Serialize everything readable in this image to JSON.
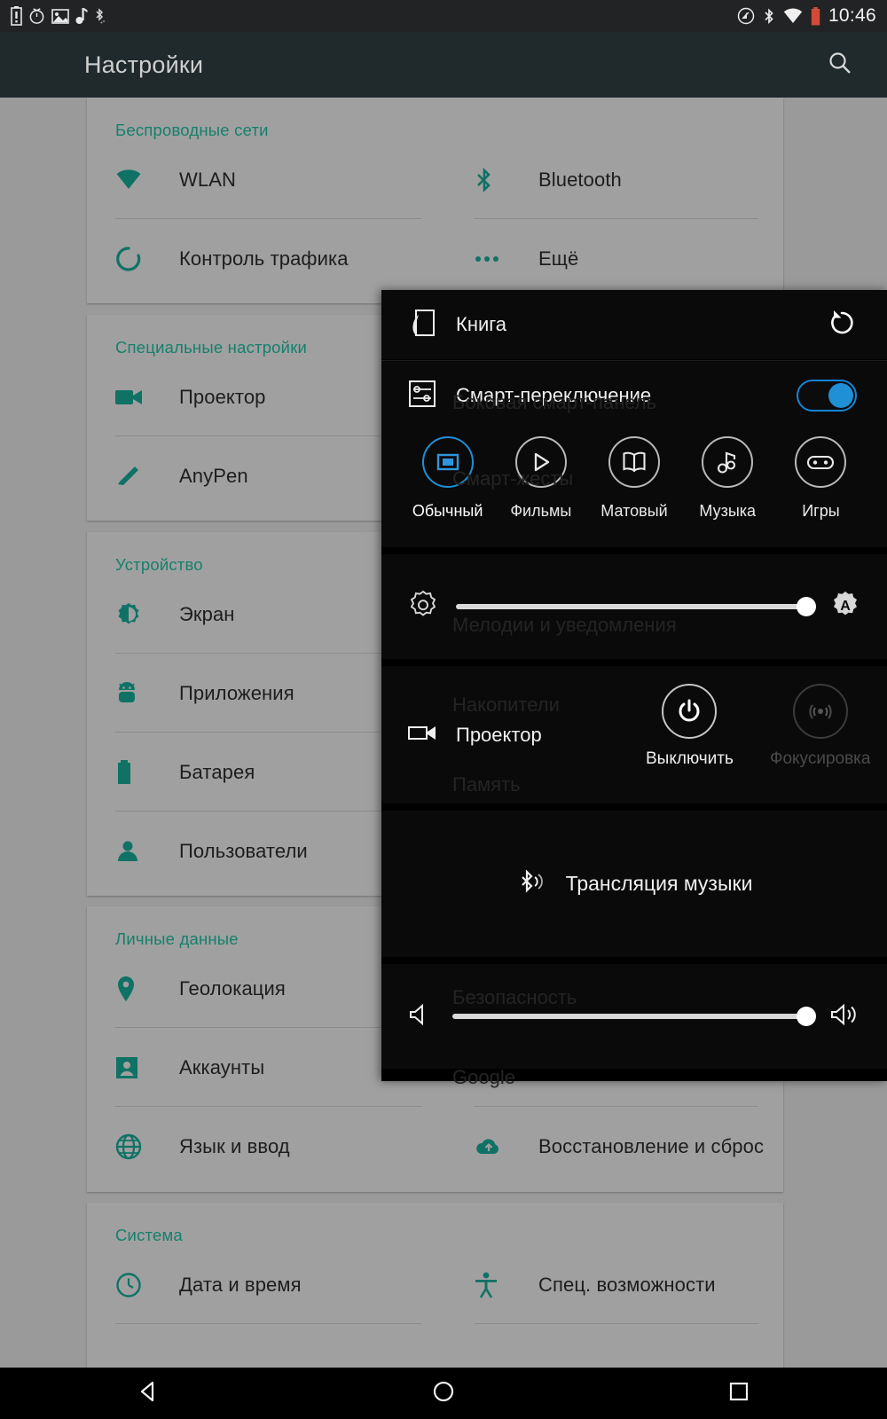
{
  "status_bar": {
    "time": "10:46",
    "left_icons": [
      "battery-alert-icon",
      "alarm-icon",
      "screenshot-icon",
      "music-note-icon",
      "bluetooth-small-icon"
    ],
    "right_icons": [
      "cast-icon",
      "bluetooth-icon",
      "wifi-icon",
      "battery-icon"
    ]
  },
  "app_bar": {
    "title": "Настройки",
    "search_icon": "search-icon"
  },
  "settings": {
    "sections": [
      {
        "title": "Беспроводные сети",
        "left_items": [
          {
            "label": "WLAN",
            "icon": "wifi-icon"
          },
          {
            "label": "Контроль трафика",
            "icon": "data-usage-icon"
          }
        ],
        "right_items": [
          {
            "label": "Bluetooth",
            "icon": "bluetooth-icon"
          },
          {
            "label": "Ещё",
            "icon": "more-icon"
          }
        ]
      },
      {
        "title": "Специальные настройки",
        "left_items": [
          {
            "label": "Проектор",
            "icon": "projector-icon"
          },
          {
            "label": "AnyPen",
            "icon": "pen-icon"
          }
        ],
        "right_items": []
      },
      {
        "title": "Устройство",
        "left_items": [
          {
            "label": "Экран",
            "icon": "display-icon"
          },
          {
            "label": "Приложения",
            "icon": "android-icon"
          },
          {
            "label": "Батарея",
            "icon": "battery-icon"
          },
          {
            "label": "Пользователи",
            "icon": "person-icon"
          }
        ],
        "right_items": [
          {
            "label": "Боковая смарт-панель",
            "icon": "smart-panel-icon"
          },
          {
            "label": "Смарт-жесты",
            "icon": "gesture-icon"
          },
          {
            "label": "Мелодии и уведомления",
            "icon": "bell-icon"
          },
          {
            "label": "Накопители",
            "icon": "storage-icon"
          },
          {
            "label": "Память",
            "icon": "memory-icon"
          }
        ]
      },
      {
        "title": "Личные данные",
        "left_items": [
          {
            "label": "Геолокация",
            "icon": "location-icon"
          },
          {
            "label": "Аккаунты",
            "icon": "account-icon"
          },
          {
            "label": "Язык и ввод",
            "icon": "language-icon"
          }
        ],
        "right_items": [
          {
            "label": "Безопасность",
            "icon": "lock-icon"
          },
          {
            "label": "Google",
            "icon": "google-icon"
          },
          {
            "label": "Восстановление и сброс",
            "icon": "backup-icon"
          }
        ]
      },
      {
        "title": "Система",
        "left_items": [
          {
            "label": "Дата и время",
            "icon": "clock-icon"
          }
        ],
        "right_items": [
          {
            "label": "Спец. возможности",
            "icon": "accessibility-icon"
          }
        ]
      }
    ]
  },
  "overlay_panel": {
    "header": {
      "title": "Книга",
      "icon": "book-mode-icon",
      "reset_icon": "reset-icon"
    },
    "smart_switch": {
      "label": "Смарт-переключение",
      "icon": "smart-switch-icon",
      "enabled": true
    },
    "display_modes": [
      {
        "label": "Обычный",
        "icon": "normal-screen-icon",
        "selected": true
      },
      {
        "label": "Фильмы",
        "icon": "play-icon",
        "selected": false
      },
      {
        "label": "Матовый",
        "icon": "book-icon",
        "selected": false
      },
      {
        "label": "Музыка",
        "icon": "music-note-icon",
        "selected": false
      },
      {
        "label": "Игры",
        "icon": "gamepad-icon",
        "selected": false
      }
    ],
    "brightness": {
      "left_icon": "brightness-icon",
      "right_icon": "auto-brightness-icon",
      "value": 100
    },
    "projector": {
      "label": "Проектор",
      "icon": "projector-icon",
      "power_button": {
        "label": "Выключить",
        "icon": "power-icon",
        "enabled": true
      },
      "focus_button": {
        "label": "Фокусировка",
        "icon": "focus-icon",
        "enabled": false
      }
    },
    "bluetooth_audio": {
      "label": "Трансляция музыки",
      "icon": "bluetooth-audio-icon"
    },
    "volume": {
      "left_icon": "volume-mute-icon",
      "right_icon": "volume-up-icon",
      "value": 100
    }
  },
  "nav_bar": {
    "back": "back-icon",
    "home": "home-icon",
    "recents": "recents-icon"
  },
  "colors": {
    "accent_teal": "#15806c",
    "accent_blue": "#1f8fd6",
    "app_bar": "#20292c",
    "status_bar": "#212325",
    "card": "#a0a0a0",
    "overlay": "#000000"
  }
}
